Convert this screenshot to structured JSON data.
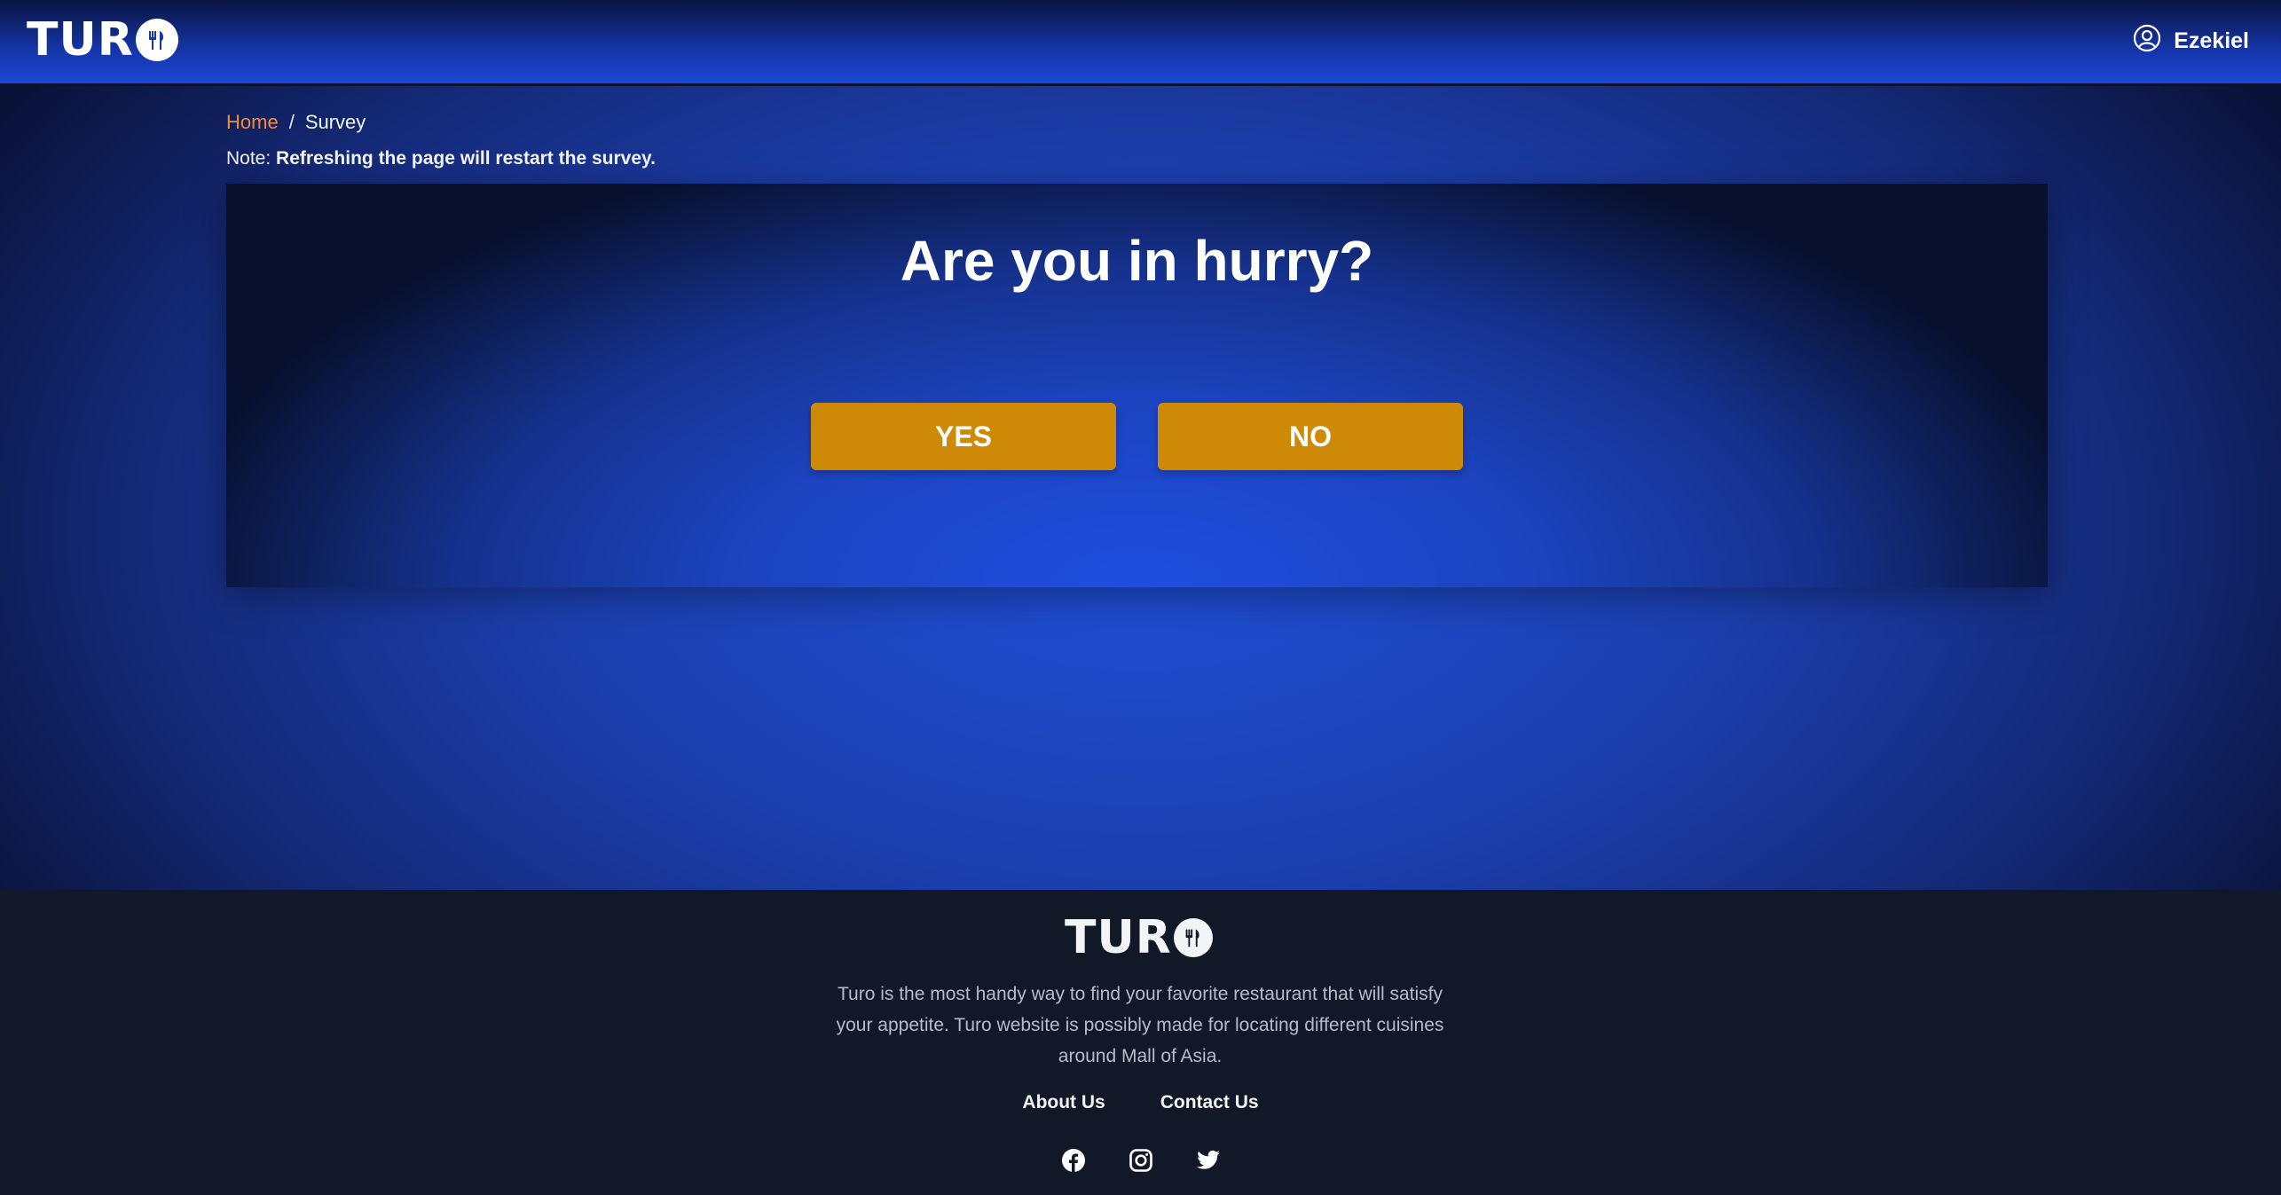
{
  "header": {
    "logo_text": "TUR",
    "user_name": "Ezekiel"
  },
  "breadcrumb": {
    "home": "Home",
    "separator": "/",
    "current": "Survey"
  },
  "note": {
    "label": "Note:",
    "text": "Refreshing the page will restart the survey."
  },
  "survey": {
    "question": "Are you in hurry?",
    "yes_label": "YES",
    "no_label": "NO"
  },
  "footer": {
    "logo_text": "TUR",
    "description": "Turo is the most handy way to find your favorite restaurant that will satisfy your appetite. Turo website is possibly made for locating different cuisines around Mall of Asia.",
    "links": [
      "About Us",
      "Contact Us"
    ],
    "social_icons": [
      "facebook-icon",
      "instagram-icon",
      "twitter-icon"
    ]
  },
  "colors": {
    "accent_button": "#ce8a07",
    "breadcrumb_link": "#f28c3a",
    "footer_bg": "#111827"
  }
}
